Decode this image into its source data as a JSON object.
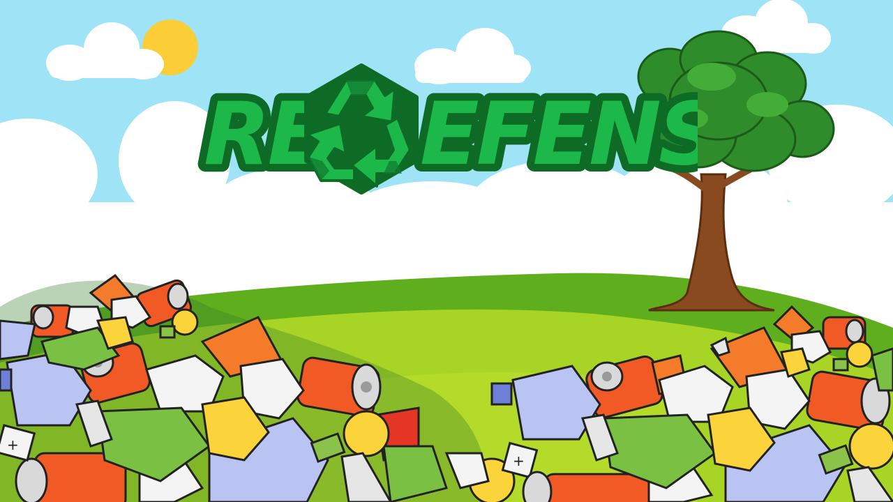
{
  "title": {
    "left_letters": "RE",
    "right_letters": "EFENSE",
    "emblem": "recycle-icon"
  },
  "colors": {
    "sky": "#9fe3f7",
    "cloud": "#ffffff",
    "sun": "#fbcd37",
    "grass_light": "#a8d426",
    "grass_dark": "#5fae1e",
    "title_fill": "#1db84a",
    "title_outline": "#0e6b26",
    "tree_leaves": "#2f8c2a",
    "tree_trunk": "#8a4a1f"
  },
  "trash_items": [
    "crushed-can-icon",
    "plastic-bottle-icon",
    "paper-ball-icon",
    "light-bulb-icon",
    "battery-icon",
    "plastic-bag-icon"
  ]
}
